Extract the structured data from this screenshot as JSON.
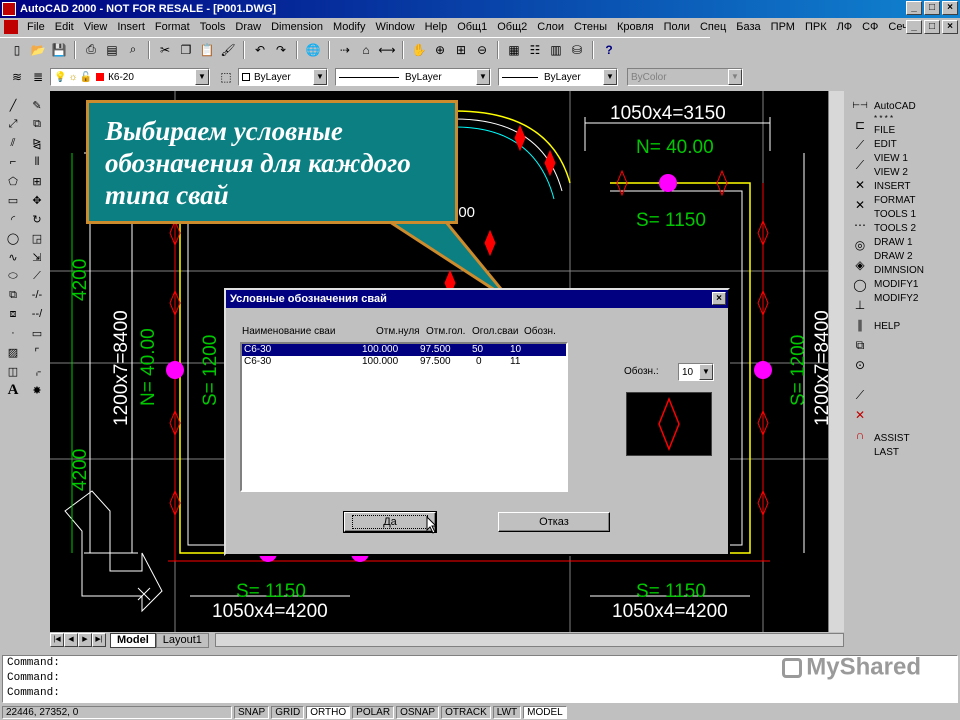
{
  "window": {
    "title": "AutoCAD 2000 - NOT FOR RESALE - [P001.DWG]",
    "min": "_",
    "max": "□",
    "close": "×"
  },
  "menu": [
    "File",
    "Edit",
    "View",
    "Insert",
    "Format",
    "Tools",
    "Draw",
    "Dimension",
    "Modify",
    "Window",
    "Help",
    "Общ1",
    "Общ2",
    "Слои",
    "Стены",
    "Кровля",
    "Поли",
    "Спец",
    "База",
    "ПРМ",
    "ПРК",
    "ЛФ",
    "СФ",
    "СечФ"
  ],
  "toolbar2": {
    "layer": "К6-20",
    "color": "ByLayer",
    "linetype": "ByLayer",
    "lineweight": "ByLayer",
    "plotstyle": "ByColor"
  },
  "drawing": {
    "dim_top": "1050x4=3150",
    "n_top": "N= 40.00",
    "s_top": "S= 1150",
    "partial_900": "900",
    "dim_left_4200_top": "4200",
    "dim_left_4200_bottom": "4200",
    "dim_left_total": "1200x7=8400",
    "n_left": "N= 40.00",
    "s_left": "S= 1200",
    "s_right": "S= 1200",
    "dim_right_total": "1200x7=8400",
    "s_bottom_left": "S= 1150",
    "dim_bottom_left": "1050x4=4200",
    "s_bottom_right": "S= 1150",
    "dim_bottom_right": "1050x4=4200",
    "colors": {
      "green": "#00c800",
      "red": "#ff0000",
      "magenta": "#ff00ff",
      "yellow": "#ffff00",
      "white": "#ffffff",
      "cyan": "#00ffff"
    }
  },
  "tabs": {
    "model": "Model",
    "layout": "Layout1"
  },
  "screen_menu": [
    "AutoCAD",
    "* * * *",
    "FILE",
    "EDIT",
    "VIEW 1",
    "VIEW 2",
    "INSERT",
    "FORMAT",
    "TOOLS 1",
    "TOOLS 2",
    "DRAW 1",
    "DRAW 2",
    "DIMNSION",
    "MODIFY1",
    "MODIFY2",
    "",
    "HELP",
    "",
    "",
    "",
    "",
    "",
    "",
    "",
    "",
    "ASSIST",
    "LAST"
  ],
  "callout": {
    "text": "Выбираем условные обозначения для каждого типа свай"
  },
  "dialog": {
    "title": "Условные обозначения свай",
    "close": "×",
    "columns": [
      "Наименование сваи",
      "Отм.нуля",
      "Отм.гол.",
      "Огол.сваи",
      "Обозн."
    ],
    "rows": [
      [
        "С6-30",
        "100.000",
        "97.500",
        "50",
        "10"
      ],
      [
        "С6-30",
        "100.000",
        "97.500",
        "0",
        "11"
      ]
    ],
    "symbol_label": "Обозн.:",
    "symbol_value": "10",
    "ok": "Да",
    "cancel": "Отказ"
  },
  "command_lines": [
    "Command:",
    "Command:",
    "Command:"
  ],
  "status": {
    "coords": "22446, 27352, 0",
    "buttons": [
      "SNAP",
      "GRID",
      "ORTHO",
      "POLAR",
      "OSNAP",
      "OTRACK",
      "LWT",
      "MODEL"
    ]
  },
  "watermark": "MyShared"
}
